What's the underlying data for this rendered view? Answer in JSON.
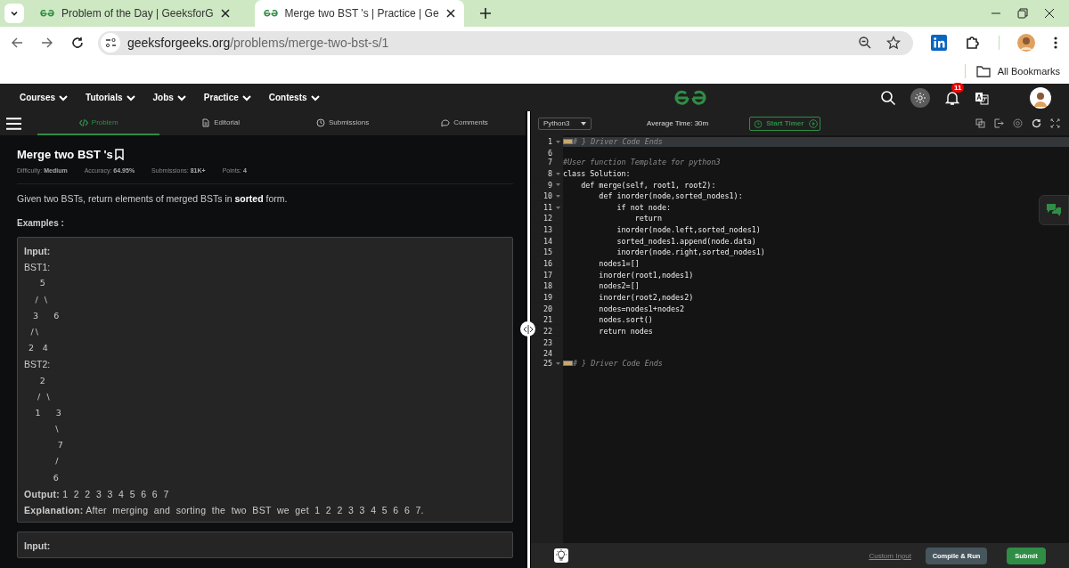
{
  "browser": {
    "tabs": [
      {
        "title": "Problem of the Day | GeeksforG",
        "selected": false
      },
      {
        "title": "Merge two BST 's | Practice | Ge",
        "selected": true
      }
    ],
    "address": {
      "host": "geeksforgeeks.org",
      "path": "/problems/merge-two-bst-s/1"
    },
    "bookmarks": [
      "All Bookmarks"
    ]
  },
  "site_nav": {
    "items": [
      "Courses",
      "Tutorials",
      "Jobs",
      "Practice",
      "Contests"
    ],
    "notification_count": "11"
  },
  "problem_tabs": [
    {
      "label": "Problem",
      "selected": true
    },
    {
      "label": "Editorial",
      "selected": false
    },
    {
      "label": "Submissions",
      "selected": false
    },
    {
      "label": "Comments",
      "selected": false
    }
  ],
  "problem": {
    "title": "Merge two BST 's",
    "meta": [
      {
        "label": "Difficulty:",
        "value": "Medium"
      },
      {
        "label": "Accuracy:",
        "value": "64.95%"
      },
      {
        "label": "Submissions:",
        "value": "81K+"
      },
      {
        "label": "Points:",
        "value": "4"
      }
    ],
    "description": "Given two BSTs, return elements of merged BSTs in **sorted** form.",
    "examples_heading": "Examples :",
    "examples": [
      {
        "lines": [
          {
            "kind": "label",
            "text": "Input:"
          },
          {
            "kind": "text",
            "text": "BST1:"
          },
          {
            "kind": "pre",
            "text": "       5"
          },
          {
            "kind": "pre",
            "text": "     /   \\"
          },
          {
            "kind": "pre",
            "text": "    3       6"
          },
          {
            "kind": "pre",
            "text": "   / \\"
          },
          {
            "kind": "pre",
            "text": "  2    4"
          },
          {
            "kind": "text",
            "text": "BST2:"
          },
          {
            "kind": "pre",
            "text": "       2"
          },
          {
            "kind": "pre",
            "text": "      /   \\"
          },
          {
            "kind": "pre",
            "text": "     1       3"
          },
          {
            "kind": "pre",
            "text": "              \\"
          },
          {
            "kind": "pre",
            "text": "               7"
          },
          {
            "kind": "pre",
            "text": "              /"
          },
          {
            "kind": "pre",
            "text": "             6"
          },
          {
            "kind": "pair",
            "label": "Output:",
            "text": "1  2  2  3  3  4  5  6  6  7"
          },
          {
            "kind": "pair",
            "label": "Explanation:",
            "text": "After  merging  and  sorting  the  two  BST  we  get  1  2  2  3  3  4  5  6  6  7."
          }
        ]
      },
      {
        "lines": [
          {
            "kind": "label",
            "text": "Input:"
          }
        ]
      }
    ]
  },
  "editor": {
    "language": "Python3",
    "average_time": "Average Time: 30m",
    "timer_label": "Start Timer",
    "code": [
      {
        "num": "1",
        "kind": "folded",
        "foldable": true,
        "text": "# } Driver Code Ends"
      },
      {
        "num": "6",
        "kind": "code",
        "foldable": false
      },
      {
        "num": "7",
        "kind": "comment",
        "foldable": false,
        "text": "#User function Template for python3"
      },
      {
        "num": "8",
        "kind": "code",
        "foldable": true,
        "text": "class Solution:"
      },
      {
        "num": "9",
        "kind": "code",
        "foldable": true,
        "text": "    def merge(self, root1, root2):"
      },
      {
        "num": "10",
        "kind": "code",
        "foldable": true,
        "text": "        def inorder(node,sorted_nodes1):"
      },
      {
        "num": "11",
        "kind": "code",
        "foldable": true,
        "text": "            if not node:"
      },
      {
        "num": "12",
        "kind": "code",
        "foldable": false,
        "text": "                return"
      },
      {
        "num": "13",
        "kind": "code",
        "foldable": false,
        "text": "            inorder(node.left,sorted_nodes1)"
      },
      {
        "num": "14",
        "kind": "code",
        "foldable": false,
        "text": "            sorted_nodes1.append(node.data)"
      },
      {
        "num": "15",
        "kind": "code",
        "foldable": false,
        "text": "            inorder(node.right,sorted_nodes1)"
      },
      {
        "num": "16",
        "kind": "code",
        "foldable": false,
        "text": "        nodes1=[]"
      },
      {
        "num": "17",
        "kind": "code",
        "foldable": false,
        "text": "        inorder(root1,nodes1)"
      },
      {
        "num": "18",
        "kind": "code",
        "foldable": false,
        "text": "        nodes2=[]"
      },
      {
        "num": "19",
        "kind": "code",
        "foldable": false,
        "text": "        inorder(root2,nodes2)"
      },
      {
        "num": "20",
        "kind": "code",
        "foldable": false,
        "text": "        nodes=nodes1+nodes2"
      },
      {
        "num": "21",
        "kind": "code",
        "foldable": false,
        "text": "        nodes.sort()"
      },
      {
        "num": "22",
        "kind": "code",
        "foldable": false,
        "text": "        return nodes"
      },
      {
        "num": "23",
        "kind": "code",
        "foldable": false
      },
      {
        "num": "24",
        "kind": "code",
        "foldable": false
      },
      {
        "num": "25",
        "kind": "folded",
        "foldable": true,
        "text": "# } Driver Code Ends"
      }
    ],
    "custom_input": "Custom Input",
    "compile_button": "Compile & Run",
    "submit_button": "Submit"
  }
}
